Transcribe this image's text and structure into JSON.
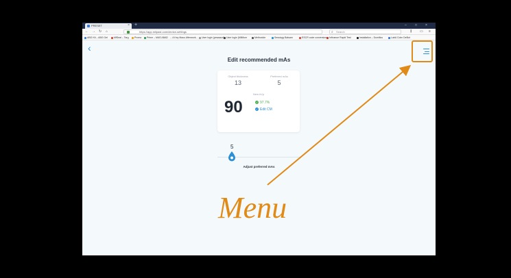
{
  "browser": {
    "tab_title": "PRESET",
    "url": "https://app.milpast.com/device-settings",
    "search_placeholder": "Search",
    "bookmarks": [
      "ABG Kit – ABG Gel",
      "MfSeal – Targ",
      "Promo",
      "Prime – MAS ABAD",
      "→ A Key Maus Afterwork...",
      "User login (pesaacol)",
      "User login (MilMom",
      "Methoxide",
      "Sessiogy Balsam",
      "ESCR code conversion",
      "Infinance Rapid Test",
      "Installation – Dumillus",
      "LabA Colm DeBot"
    ]
  },
  "page": {
    "title": "Edit recommended mAs",
    "object_thickness": {
      "label": "Object thickness",
      "value": "13"
    },
    "preferred_mas": {
      "label": "Preferred mAs",
      "value": "5"
    },
    "kvp": {
      "label": "New kVp",
      "value": "90"
    },
    "percent": "97.7%",
    "edit_cm": "Edit CM",
    "slider": {
      "value": "5",
      "caption": "Adjust preferred mAs"
    }
  },
  "annotation": {
    "text": "Menu"
  },
  "colors": {
    "accent": "#2a8fd4",
    "annotation": "#e08a17",
    "success": "#4cb050"
  }
}
